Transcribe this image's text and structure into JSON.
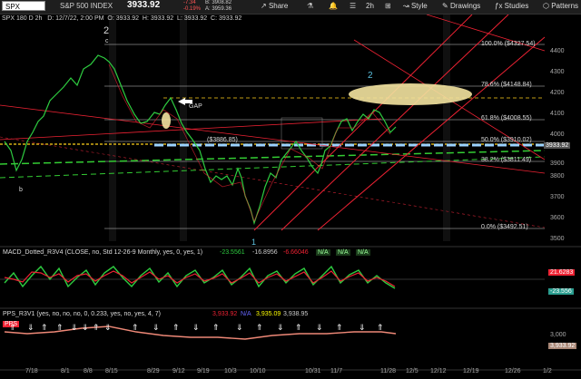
{
  "toolbar": {
    "symbol": "SPX",
    "description": "S&P 500 INDEX",
    "last": "3933.92",
    "change": "-7.34",
    "change_pct": "-0.19%",
    "bid": "B: 3908.82",
    "ask": "A: 3959.36",
    "share": "Share",
    "timeframe": "2h",
    "style": "Style",
    "drawings": "Drawings",
    "studies": "Studies",
    "patterns": "Patterns"
  },
  "header": {
    "info": "SPX 180 D 2h",
    "date": "D: 12/7/22, 2:00 PM",
    "open": "O: 3933.92",
    "high": "H: 3933.92",
    "low": "L: 3933.92",
    "close": "C: 3933.92"
  },
  "price_pane": {
    "wave_2_top": "2",
    "wave_c": "c",
    "wave_b": "b",
    "wave_1": "1",
    "wave_2_right": "2",
    "gap": "GAP",
    "fib_100": "100.0% ($4327.54)",
    "fib_786": "78.6% ($4148.84)",
    "fib_618": "61.8% ($4008.55)",
    "fib_50": "50.0% ($3910.02)",
    "fib_382": "38.2% ($3811.49)",
    "fib_0": "0.0% ($3492.51)",
    "box_label": "($3886.85)",
    "price_tag": "3933.92",
    "y_ticks": [
      "4400",
      "4300",
      "4200",
      "4100",
      "4000",
      "3900",
      "3800",
      "3700",
      "3600",
      "3500"
    ]
  },
  "macd_pane": {
    "title": "MACD_Dotted_R3V4 (CLOSE, no, Std 12-26-9 Monthly, yes, 0, yes, 1)",
    "v1": "-23.5561",
    "v2": "-16.8956",
    "v3": "-6.66046",
    "na": "N/A",
    "tag_red": "21.6283",
    "tag_green": "-23.556"
  },
  "pps_pane": {
    "title": "PPS_R3V1 (yes, no, no, no, 0, 0.233, yes, no, yes, 4, 7)",
    "v1": "3,933.92",
    "v2": "3,935.09",
    "v3": "3,938.95",
    "na": "N/A",
    "badge": "PPS",
    "y_tick": "3,000",
    "price_tag": "3,933.92"
  },
  "x_axis": [
    "7/18",
    "8/1",
    "8/8",
    "8/15",
    "8/29",
    "9/12",
    "9/19",
    "10/3",
    "10/10",
    "10/31",
    "11/7",
    "11/28",
    "12/5",
    "12/12",
    "12/19",
    "12/26",
    "1/2"
  ]
}
